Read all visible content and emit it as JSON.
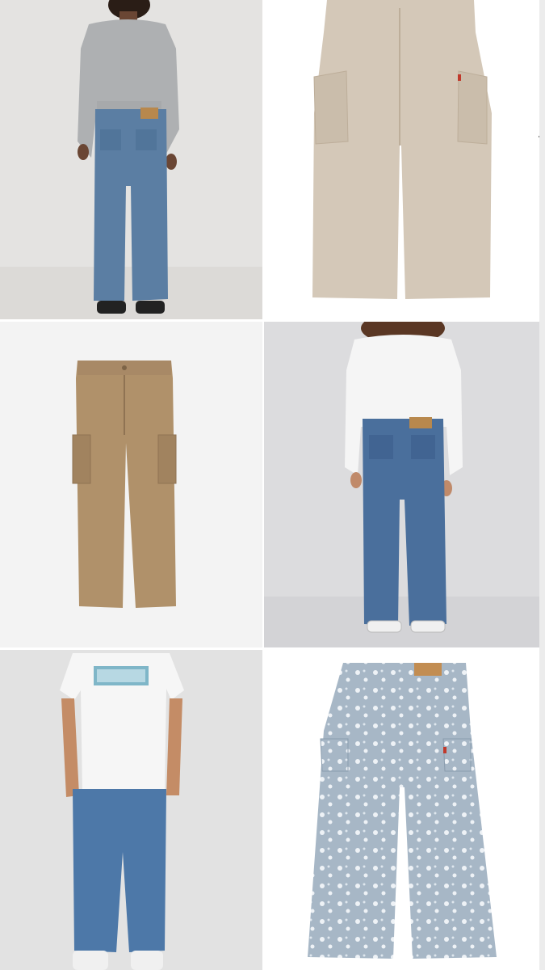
{
  "grid": {
    "products": [
      {
        "image": "boy-in-grey-sweater-blue-jeans-back-view",
        "background": "#e4e3e1"
      },
      {
        "image": "beige-cargo-pants",
        "background": "#ffffff"
      },
      {
        "image": "tan-cargo-pants",
        "background": "#f3f3f3"
      },
      {
        "image": "girl-in-white-sweater-blue-jeans-back-view",
        "background": "#dcdcde"
      },
      {
        "image": "boy-in-white-logo-tee-blue-jeans-front-view",
        "background": "#e2e2e2"
      },
      {
        "image": "floral-print-cargo-pants",
        "background": "#ffffff"
      }
    ],
    "carousel_arrows": {
      "prev_icon": "chevron-left-icon",
      "next_icon": "chevron-right-icon"
    }
  }
}
